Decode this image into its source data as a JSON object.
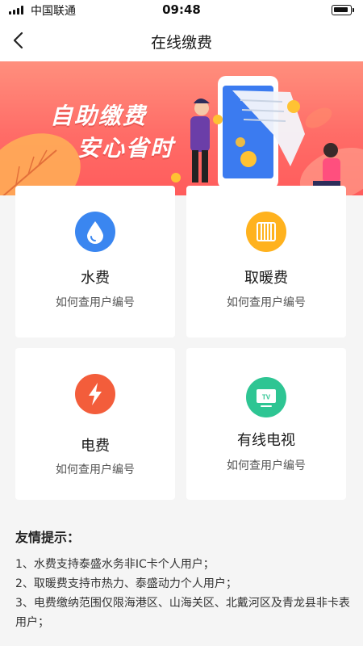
{
  "status_bar": {
    "carrier": "中国联通",
    "time": "09:48"
  },
  "nav": {
    "title": "在线缴费"
  },
  "banner": {
    "line1": "自助缴费",
    "line2": "安心省时"
  },
  "cards": [
    {
      "title": "水费",
      "subtitle": "如何查用户编号",
      "icon": "water-drop-icon",
      "color": "#3a86f0"
    },
    {
      "title": "取暖费",
      "subtitle": "如何查用户编号",
      "icon": "radiator-icon",
      "color": "#ffb21e"
    },
    {
      "title": "电费",
      "subtitle": "如何查用户编号",
      "icon": "lightning-icon",
      "color": "#f35d3b"
    },
    {
      "title": "有线电视",
      "subtitle": "如何查用户编号",
      "icon": "tv-icon",
      "color": "#2ec593"
    }
  ],
  "tips": {
    "title": "友情提示：",
    "items": [
      "1、水费支持泰盛水务非IC卡个人用户；",
      "2、取暖费支持市热力、泰盛动力个人用户；",
      "3、电费缴纳范围仅限海港区、山海关区、北戴河区及青龙县非卡表用户；"
    ]
  }
}
